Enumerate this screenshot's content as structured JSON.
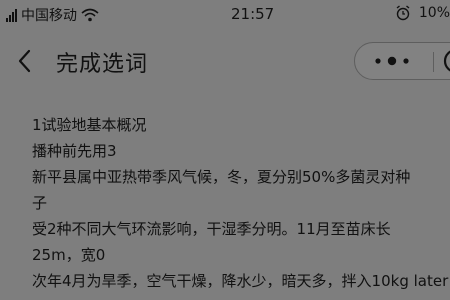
{
  "status_bar": {
    "carrier": "中国移动",
    "time": "21:57",
    "battery": "10%",
    "icons": [
      "signal-icon",
      "wifi-icon",
      "alarm-icon"
    ]
  },
  "header": {
    "title": "完成选词",
    "icons": [
      "back-icon",
      "more-icon",
      "close-icon"
    ]
  },
  "content": {
    "lines": [
      "1试验地基本概况",
      "播种前先用3",
      "新平县属中亚热带季风气候，冬，夏分别50%多菌灵对种",
      "子",
      "受2种不同大气环流影响，干湿季分明。11月至苗床长",
      "25m，宽0",
      "次年4月为旱季，空气干燥，降水少，暗天多，拌入10kg later"
    ]
  }
}
